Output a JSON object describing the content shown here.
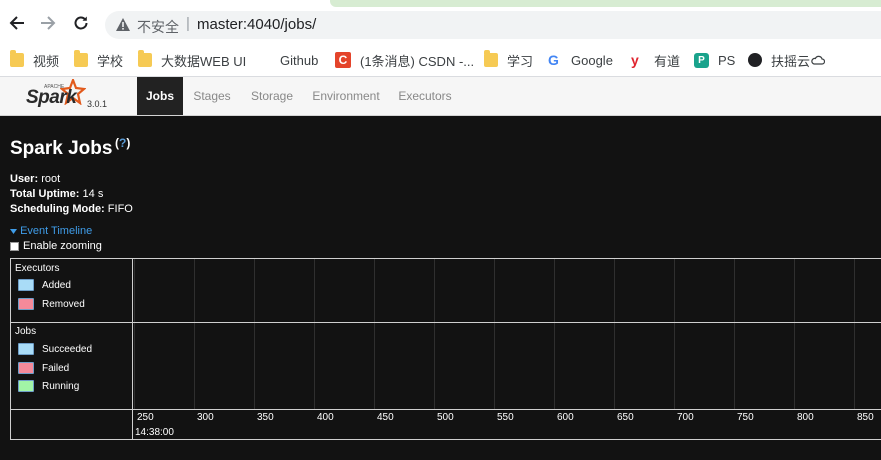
{
  "browser": {
    "insecure_label": "不安全",
    "url": "master:4040/jobs/",
    "bookmarks": [
      {
        "label": "视频",
        "icon": "folder-icon"
      },
      {
        "label": "学校",
        "icon": "folder-icon"
      },
      {
        "label": "大数据WEB UI",
        "icon": "folder-icon"
      },
      {
        "label": "Github",
        "icon": "github-icon"
      },
      {
        "label": "(1条消息) CSDN -...",
        "icon": "csdn-icon"
      },
      {
        "label": "学习",
        "icon": "folder-icon"
      },
      {
        "label": "Google",
        "icon": "google-icon"
      },
      {
        "label": "有道",
        "icon": "youdao-icon"
      },
      {
        "label": "PS",
        "icon": "ps-icon"
      },
      {
        "label": "扶摇云",
        "icon": "globe-icon"
      }
    ]
  },
  "navbar": {
    "logo_apache": "APACHE",
    "logo_word": "Spark",
    "version": "3.0.1",
    "tabs": [
      "Jobs",
      "Stages",
      "Storage",
      "Environment",
      "Executors"
    ],
    "active_tab": "Jobs"
  },
  "page": {
    "title": "Spark Jobs",
    "help": "?",
    "user_label": "User:",
    "user_value": "root",
    "uptime_label": "Total Uptime:",
    "uptime_value": "14 s",
    "mode_label": "Scheduling Mode:",
    "mode_value": "FIFO",
    "event_timeline": "Event Timeline",
    "enable_zooming": "Enable zooming"
  },
  "timeline": {
    "executors_group": "Executors",
    "executors_legend": [
      {
        "label": "Added",
        "color": "#a9dcf7"
      },
      {
        "label": "Removed",
        "color": "#f58a9a"
      }
    ],
    "jobs_group": "Jobs",
    "jobs_legend": [
      {
        "label": "Succeeded",
        "color": "#a9dcf7"
      },
      {
        "label": "Failed",
        "color": "#f58a9a"
      },
      {
        "label": "Running",
        "color": "#a2f5a6"
      }
    ],
    "axis_ticks": [
      "250",
      "300",
      "350",
      "400",
      "450",
      "500",
      "550",
      "600",
      "650",
      "700",
      "750",
      "800",
      "850"
    ],
    "axis_time": "14:38:00"
  }
}
